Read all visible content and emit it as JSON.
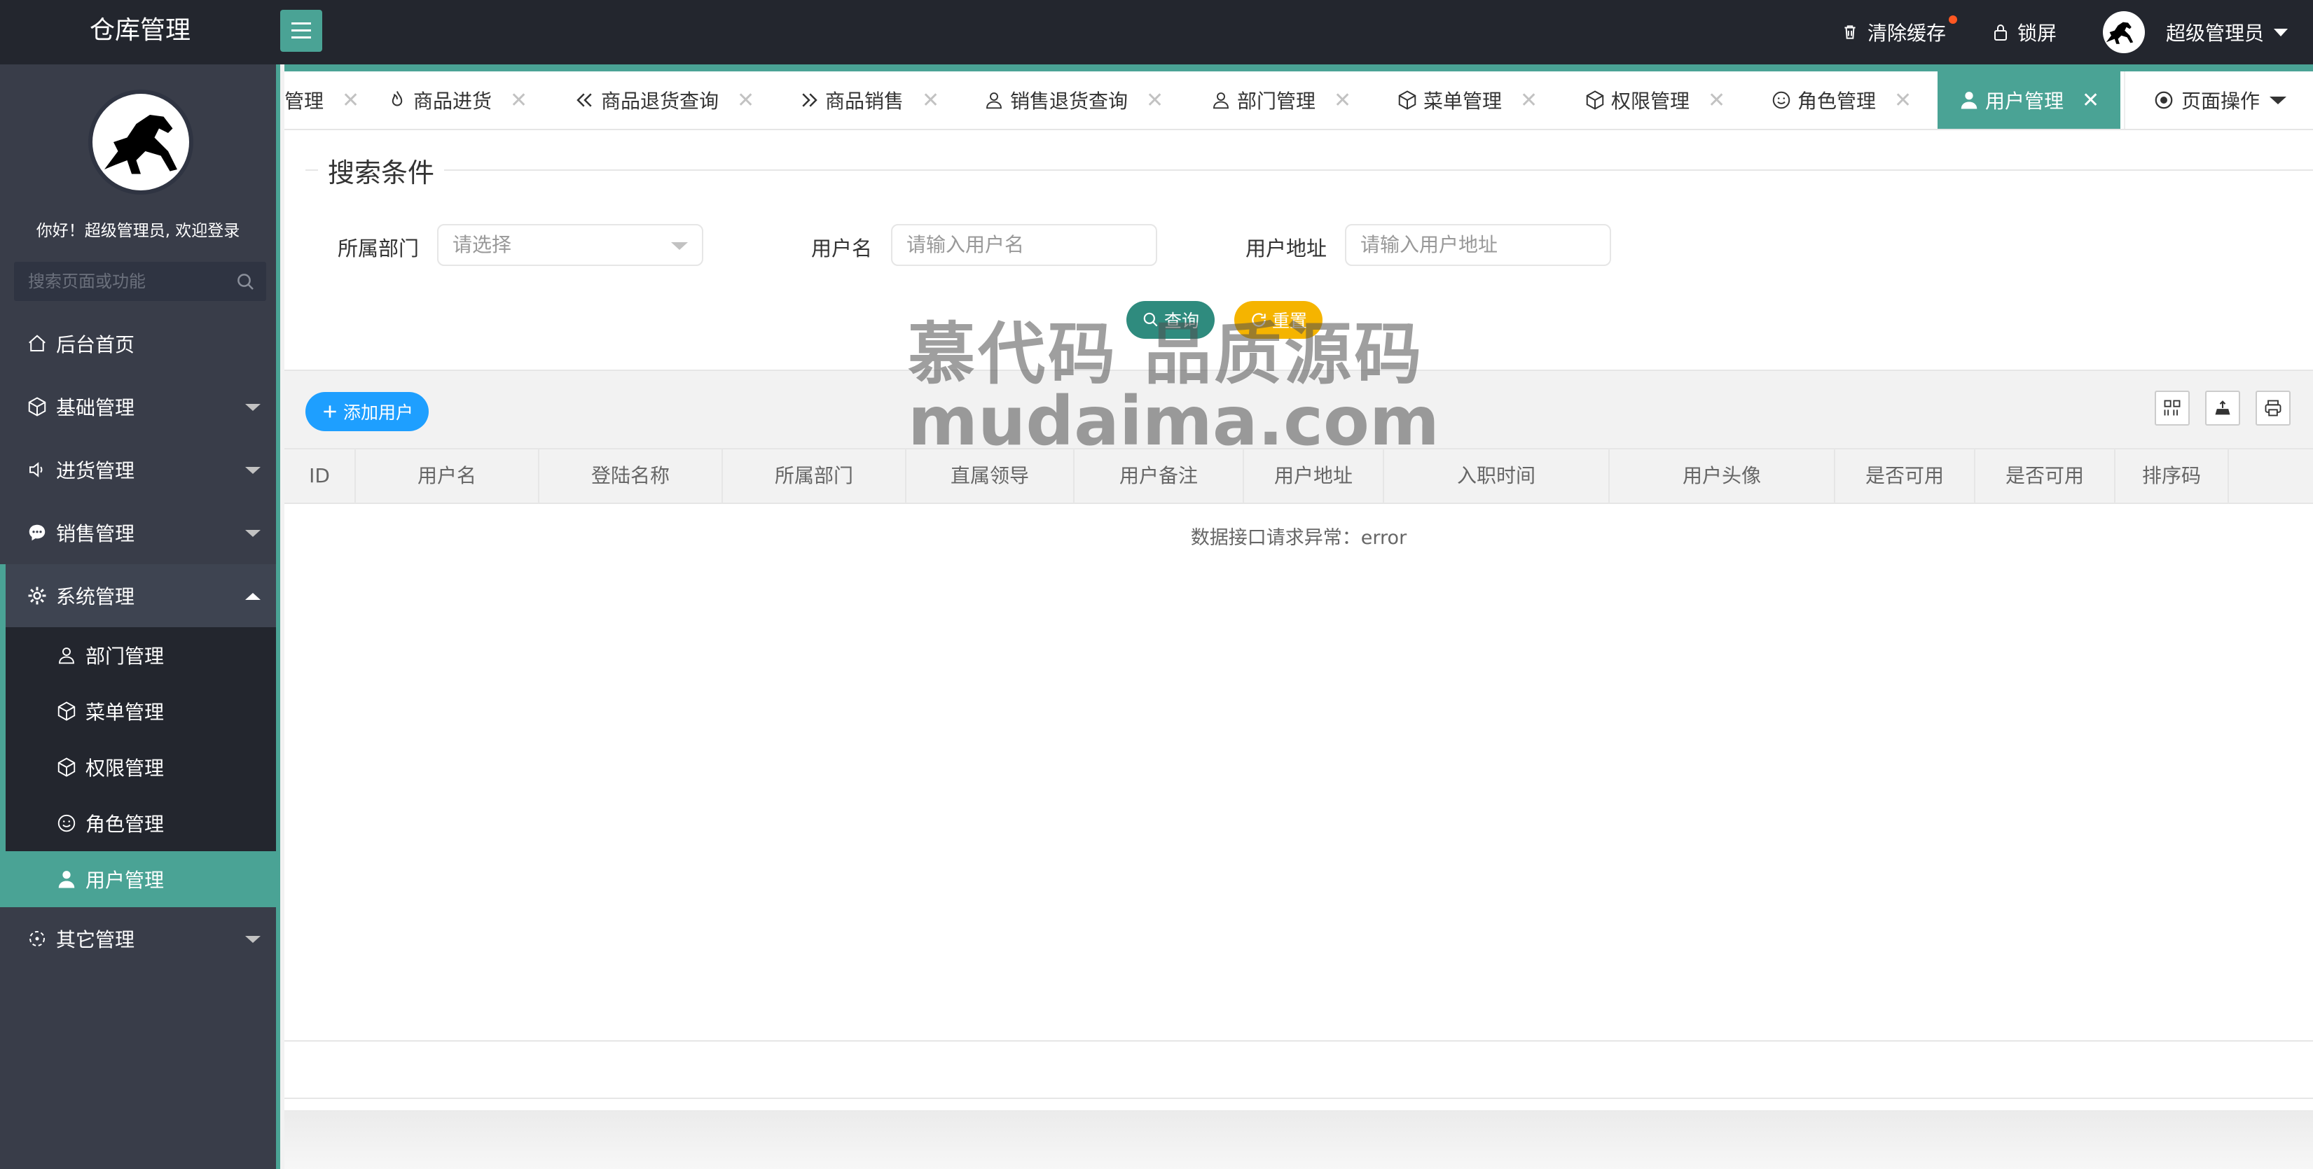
{
  "app": {
    "title": "仓库管理"
  },
  "header": {
    "clear_cache": "清除缓存",
    "lock_screen": "锁屏",
    "user_name": "超级管理员"
  },
  "sidebar": {
    "welcome": "你好！超级管理员, 欢迎登录",
    "search_placeholder": "搜索页面或功能",
    "items": [
      {
        "label": "后台首页",
        "icon": "home-icon"
      },
      {
        "label": "基础管理",
        "icon": "cube-icon"
      },
      {
        "label": "进货管理",
        "icon": "speaker-icon"
      },
      {
        "label": "销售管理",
        "icon": "chat-icon"
      },
      {
        "label": "系统管理",
        "icon": "gear-icon"
      },
      {
        "label": "其它管理",
        "icon": "loader-icon"
      }
    ],
    "sub_items": [
      {
        "label": "部门管理",
        "icon": "user-outline-icon"
      },
      {
        "label": "菜单管理",
        "icon": "cube-icon"
      },
      {
        "label": "权限管理",
        "icon": "cube-icon"
      },
      {
        "label": "角色管理",
        "icon": "smile-icon"
      },
      {
        "label": "用户管理",
        "icon": "user-icon"
      }
    ]
  },
  "tabs": [
    {
      "label": "管理"
    },
    {
      "label": "商品进货"
    },
    {
      "label": "商品退货查询"
    },
    {
      "label": "商品销售"
    },
    {
      "label": "销售退货查询"
    },
    {
      "label": "部门管理"
    },
    {
      "label": "菜单管理"
    },
    {
      "label": "权限管理"
    },
    {
      "label": "角色管理"
    },
    {
      "label": "用户管理"
    }
  ],
  "page_ops": "页面操作",
  "search": {
    "legend": "搜索条件",
    "dept_label": "所属部门",
    "dept_placeholder": "请选择",
    "username_label": "用户名",
    "username_placeholder": "请输入用户名",
    "address_label": "用户地址",
    "address_placeholder": "请输入用户地址",
    "query_button": "查询",
    "reset_button": "重置"
  },
  "toolbar": {
    "add_button": "添加用户"
  },
  "table": {
    "columns": [
      "ID",
      "用户名",
      "登陆名称",
      "所属部门",
      "直属领导",
      "用户备注",
      "用户地址",
      "入职时间",
      "用户头像",
      "是否可用",
      "是否可用",
      "排序码"
    ],
    "empty_message": "数据接口请求异常：error"
  },
  "watermark": {
    "line1": "慕代码 品质源码",
    "line2": "mudaima.com"
  },
  "colors": {
    "accent": "#4aa395",
    "header_bg": "#23262e",
    "sidebar_bg": "#393d49",
    "add_button": "#1e9fff",
    "reset_button": "#f5b400"
  }
}
